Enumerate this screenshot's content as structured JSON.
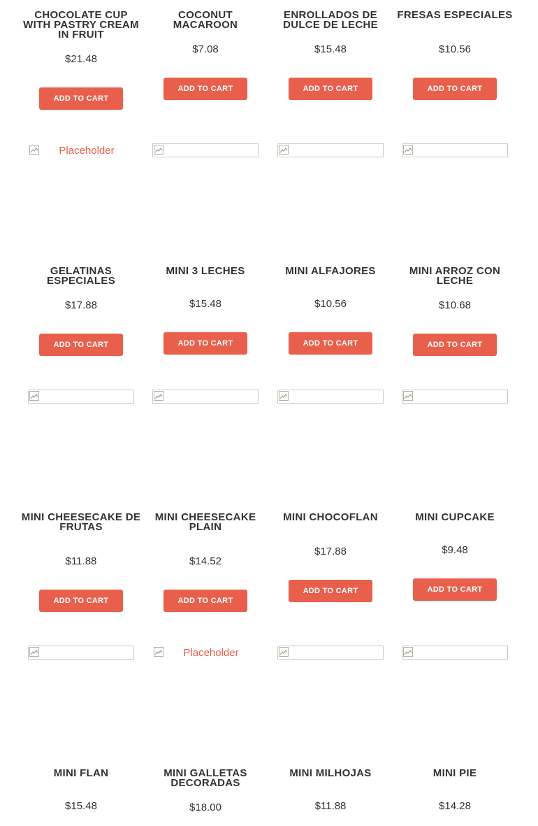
{
  "add_to_cart_label": "Add to cart",
  "placeholder_alt": "Placeholder",
  "colors": {
    "accent": "#e8604c",
    "text": "#333333",
    "frame": "#c9c9c9"
  },
  "products": [
    {
      "name": "Chocolate Cup with Pastry Cream in Fruit",
      "price": "$21.48"
    },
    {
      "name": "Coconut Macaroon",
      "price": "$7.08"
    },
    {
      "name": "Enrollados de Dulce de Leche",
      "price": "$15.48"
    },
    {
      "name": "Fresas Especiales",
      "price": "$10.56"
    },
    {
      "name": "Gelatinas Especiales",
      "price": "$17.88",
      "image": "placeholder"
    },
    {
      "name": "Mini 3 Leches",
      "price": "$15.48",
      "image": "broken"
    },
    {
      "name": "Mini Alfajores",
      "price": "$10.56",
      "image": "broken"
    },
    {
      "name": "Mini Arroz con Leche",
      "price": "$10.68",
      "image": "broken"
    },
    {
      "name": "Mini Cheesecake de Frutas",
      "price": "$11.88",
      "image": "broken"
    },
    {
      "name": "Mini Cheesecake Plain",
      "price": "$14.52",
      "image": "broken"
    },
    {
      "name": "Mini Chocoflan",
      "price": "$17.88",
      "image": "broken"
    },
    {
      "name": "Mini Cupcake",
      "price": "$9.48",
      "image": "broken"
    },
    {
      "name": "Mini Flan",
      "price": "$15.48",
      "image": "broken"
    },
    {
      "name": "Mini Galletas Decoradas",
      "price": "$18.00",
      "image": "placeholder"
    },
    {
      "name": "Mini Milhojas",
      "price": "$11.88",
      "image": "broken"
    },
    {
      "name": "Mini Pie",
      "price": "$14.28",
      "image": "broken"
    }
  ]
}
